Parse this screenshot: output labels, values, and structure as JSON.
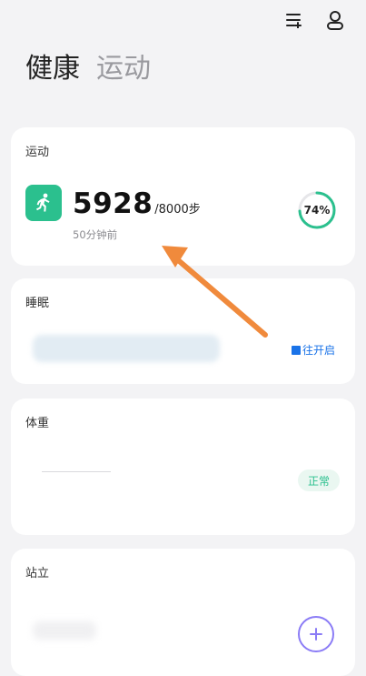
{
  "header": {
    "tab_health": "健康",
    "tab_sport": "运动"
  },
  "icons": {
    "top_left_action": "playlist-add-icon",
    "top_right_action": "user-icon",
    "sport": "running-person-icon",
    "add": "plus-icon"
  },
  "cards": {
    "sport": {
      "title": "运动",
      "steps": "5928",
      "goal": "/8000步",
      "updated": "50分钟前",
      "progress_percent": "74%",
      "progress_value": 74
    },
    "sleep": {
      "title": "睡眠",
      "action_label": "往开启"
    },
    "weight": {
      "title": "体重",
      "status": "正常"
    },
    "stand": {
      "title": "站立"
    }
  },
  "colors": {
    "accent_green": "#2bc08e",
    "link_blue": "#1a73e8",
    "ring_purple": "#8b7cf6",
    "annotation_orange": "#f08a3c"
  }
}
